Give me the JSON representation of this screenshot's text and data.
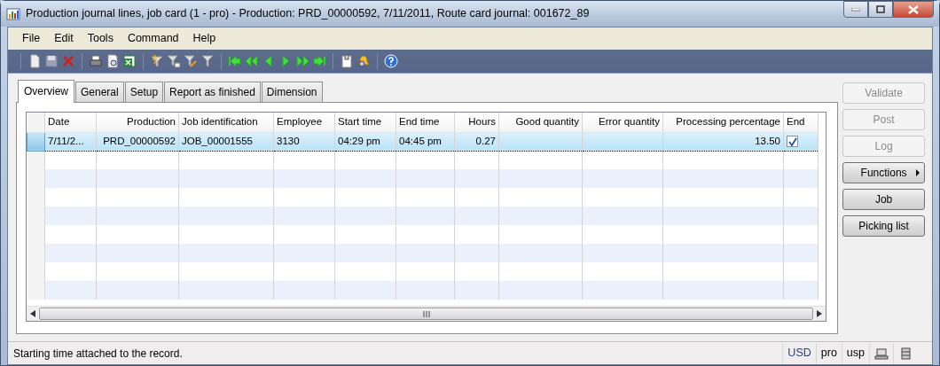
{
  "window": {
    "title": "Production journal lines, job card (1 - pro) - Production: PRD_00000592, 7/11/2011, Route card journal: 001672_89"
  },
  "menu": [
    "File",
    "Edit",
    "Tools",
    "Command",
    "Help"
  ],
  "tabs": [
    {
      "label": "Overview",
      "selected": true
    },
    {
      "label": "General",
      "selected": false
    },
    {
      "label": "Setup",
      "selected": false
    },
    {
      "label": "Report as finished",
      "selected": false
    },
    {
      "label": "Dimension",
      "selected": false
    }
  ],
  "table": {
    "columns": [
      {
        "label": "Date",
        "kind": "text"
      },
      {
        "label": "Production",
        "kind": "number"
      },
      {
        "label": "Job identification",
        "kind": "text"
      },
      {
        "label": "Employee",
        "kind": "text"
      },
      {
        "label": "Start time",
        "kind": "text"
      },
      {
        "label": "End time",
        "kind": "text"
      },
      {
        "label": "Hours",
        "kind": "number"
      },
      {
        "label": "Good quantity",
        "kind": "number"
      },
      {
        "label": "Error quantity",
        "kind": "number"
      },
      {
        "label": "Processing percentage",
        "kind": "number"
      },
      {
        "label": "End",
        "kind": "checkbox"
      }
    ],
    "rows": [
      {
        "selected": true,
        "cells": [
          "7/11/2...",
          "PRD_00000592",
          "JOB_00001555",
          "3130",
          "04:29 pm",
          "04:45 pm",
          "0.27",
          "",
          "",
          "13.50"
        ],
        "end_checked": true
      }
    ]
  },
  "buttons": [
    {
      "label": "Validate",
      "disabled": true,
      "kind": "plain"
    },
    {
      "label": "Post",
      "disabled": true,
      "kind": "plain"
    },
    {
      "label": "Log",
      "disabled": true,
      "kind": "plain"
    },
    {
      "label": "Functions",
      "disabled": false,
      "kind": "submenu"
    },
    {
      "label": "Job",
      "disabled": false,
      "kind": "plain"
    },
    {
      "label": "Picking list",
      "disabled": false,
      "kind": "plain"
    }
  ],
  "status_bar": {
    "message": "Starting time attached to the record.",
    "fields": [
      {
        "text": "USD",
        "color": "#1f3f9f"
      },
      {
        "text": "pro",
        "color": "#000000"
      },
      {
        "text": "usp",
        "color": "#000000"
      }
    ]
  }
}
